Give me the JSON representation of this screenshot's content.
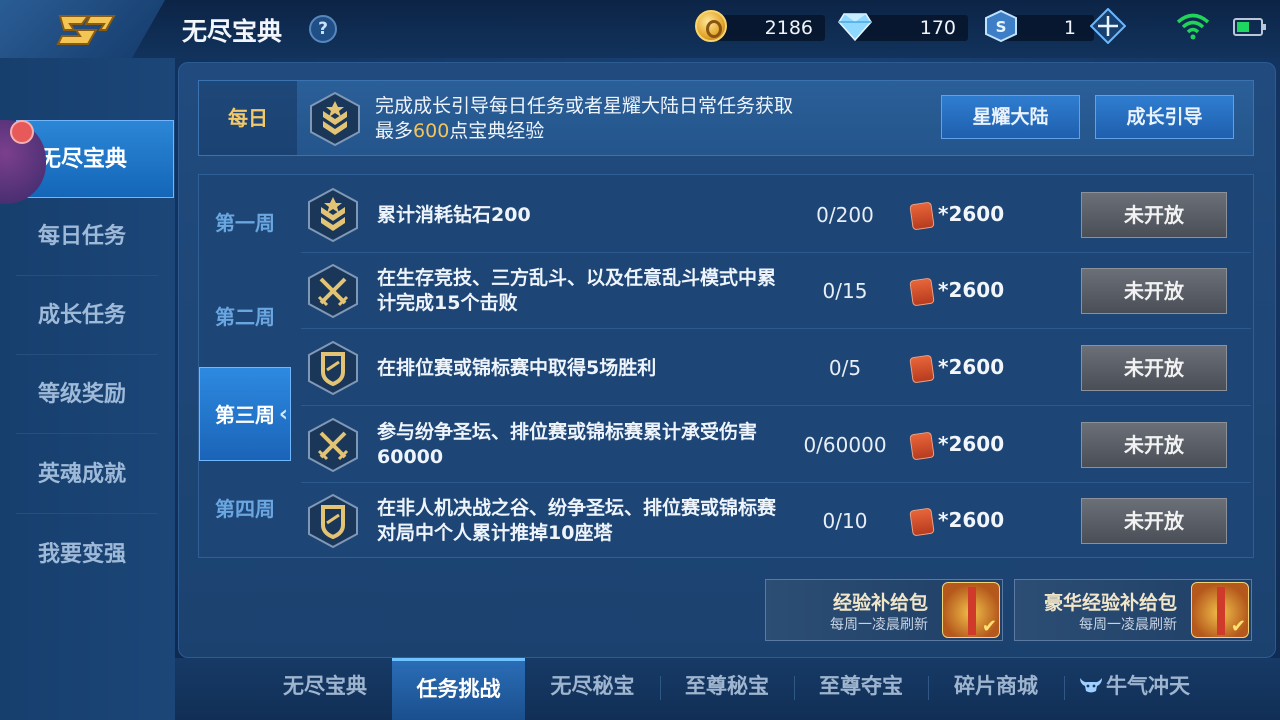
{
  "header": {
    "title": "无尽宝典",
    "help_glyph": "?",
    "currencies": [
      {
        "icon": "gold-coin-icon",
        "value": "2186"
      },
      {
        "icon": "diamond-icon",
        "value": "170"
      },
      {
        "icon": "voucher-icon",
        "value": "1"
      }
    ]
  },
  "sidebar": {
    "items": [
      {
        "label": "无尽宝典",
        "active": true
      },
      {
        "label": "每日任务"
      },
      {
        "label": "成长任务"
      },
      {
        "label": "等级奖励"
      },
      {
        "label": "英魂成就"
      },
      {
        "label": "我要变强"
      }
    ]
  },
  "daily": {
    "tag": "每日",
    "line1": "完成成长引导每日任务或者星耀大陆日常任务获取",
    "line2_prefix": "最多",
    "line2_highlight": "600",
    "line2_suffix": "点宝典经验",
    "button_1": "星耀大陆",
    "button_2": "成长引导"
  },
  "weeks": [
    "第一周",
    "第二周",
    "第三周",
    "第四周"
  ],
  "active_week": "第三周",
  "tasks": [
    {
      "title": "累计消耗钻石200",
      "progress": "0/200",
      "reward": "*2600",
      "state": "未开放",
      "icon": "rank-badge-icon"
    },
    {
      "title": "在生存竞技、三方乱斗、以及任意乱斗模式中累计完成15个击败",
      "progress": "0/15",
      "reward": "*2600",
      "state": "未开放",
      "icon": "crossed-swords-icon"
    },
    {
      "title": "在排位赛或锦标赛中取得5场胜利",
      "progress": "0/5",
      "reward": "*2600",
      "state": "未开放",
      "icon": "shield-icon"
    },
    {
      "title": "参与纷争圣坛、排位赛或锦标赛累计承受伤害60000",
      "progress": "0/60000",
      "reward": "*2600",
      "state": "未开放",
      "icon": "crossed-swords-icon"
    },
    {
      "title": "在非人机决战之谷、纷争圣坛、排位赛或锦标赛对局中个人累计推掉10座塔",
      "progress": "0/10",
      "reward": "*2600",
      "state": "未开放",
      "icon": "shield-icon"
    }
  ],
  "packs": [
    {
      "title": "经验补给包",
      "subtitle": "每周一凌晨刷新"
    },
    {
      "title": "豪华经验补给包",
      "subtitle": "每周一凌晨刷新"
    }
  ],
  "tabs": [
    "无尽宝典",
    "任务挑战",
    "无尽秘宝",
    "至尊秘宝",
    "至尊夺宝",
    "碎片商城",
    "牛气冲天"
  ],
  "active_tab": "任务挑战",
  "colors": {
    "accent": "#f4c35a",
    "active_blue": "#2d8ae0",
    "locked_gray": "#5a5f67"
  }
}
